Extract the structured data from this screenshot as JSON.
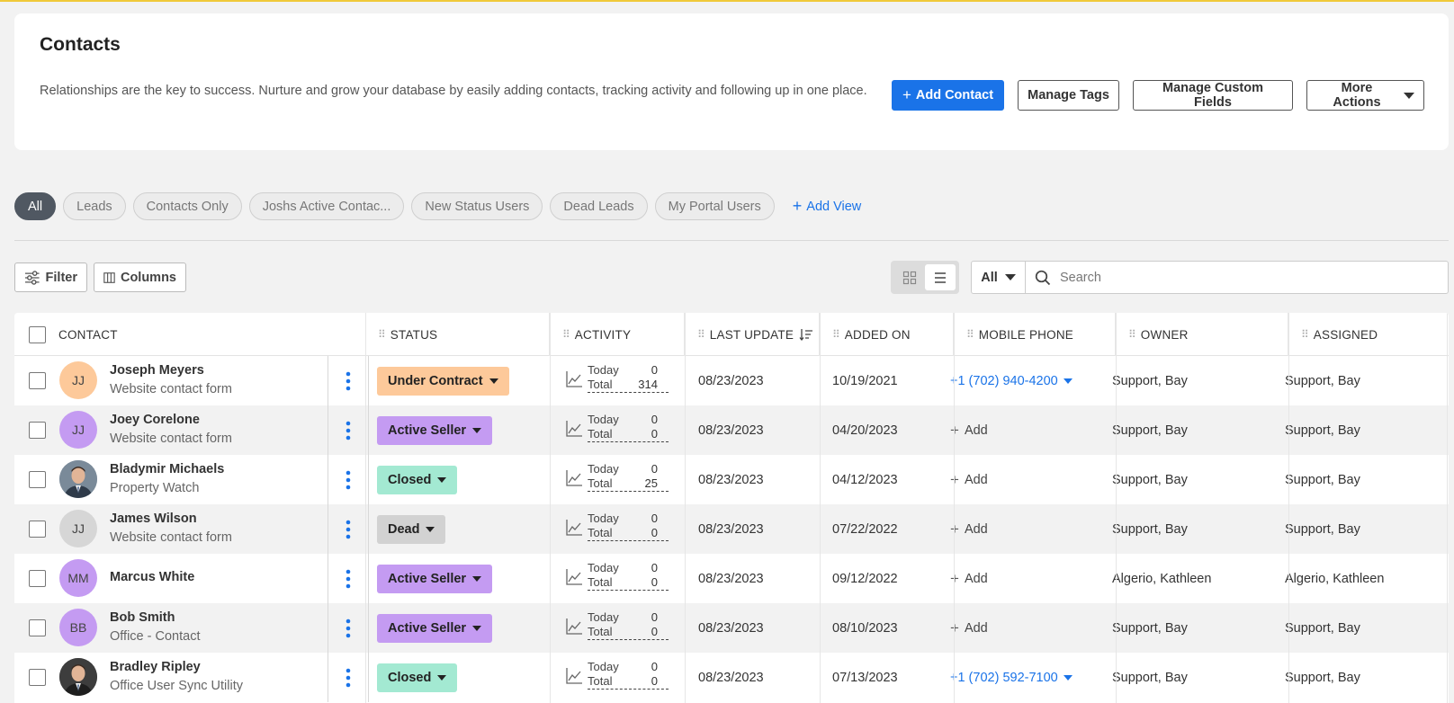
{
  "header": {
    "title": "Contacts",
    "description": "Relationships are the key to success. Nurture and grow your database by easily adding contacts, tracking activity and following up in one place.",
    "add_contact": "Add Contact",
    "manage_tags": "Manage Tags",
    "manage_custom_fields": "Manage Custom Fields",
    "more_actions": "More Actions"
  },
  "views": [
    "All",
    "Leads",
    "Contacts Only",
    "Joshs Active Contac...",
    "New Status Users",
    "Dead Leads",
    "My Portal Users"
  ],
  "add_view": "Add View",
  "toolbar": {
    "filter": "Filter",
    "columns": "Columns",
    "scope": "All",
    "search_placeholder": "Search"
  },
  "columns": [
    "CONTACT",
    "STATUS",
    "ACTIVITY",
    "LAST UPDATE",
    "ADDED ON",
    "MOBILE PHONE",
    "OWNER",
    "ASSIGNED"
  ],
  "activity_labels": {
    "today": "Today",
    "total": "Total"
  },
  "add_label": "Add",
  "colors": {
    "accent": "#1a73e8",
    "under_contract": "#fdc99a",
    "active_seller": "#c49bf2",
    "closed": "#a3e9d2",
    "dead": "#d2d2d2"
  },
  "contacts": [
    {
      "initials": "JJ",
      "avatar_color": "#fdc99a",
      "photo": false,
      "name": "Joseph Meyers",
      "source": "Website contact form",
      "status": "Under Contract",
      "status_color": "#fdc99a",
      "today": "0",
      "total": "314",
      "last_update": "08/23/2023",
      "added_on": "10/19/2021",
      "phone": "+1 (702) 940-4200",
      "owner": "Support, Bay",
      "assigned": "Support, Bay"
    },
    {
      "initials": "JJ",
      "avatar_color": "#c49bf2",
      "photo": false,
      "name": "Joey Corelone",
      "source": "Website contact form",
      "status": "Active Seller",
      "status_color": "#c49bf2",
      "today": "0",
      "total": "0",
      "last_update": "08/23/2023",
      "added_on": "04/20/2023",
      "phone": null,
      "owner": "Support, Bay",
      "assigned": "Support, Bay"
    },
    {
      "initials": "",
      "avatar_color": "#7a8a99",
      "photo": true,
      "name": "Bladymir Michaels",
      "source": "Property Watch",
      "status": "Closed",
      "status_color": "#a3e9d2",
      "today": "0",
      "total": "25",
      "last_update": "08/23/2023",
      "added_on": "04/12/2023",
      "phone": null,
      "owner": "Support, Bay",
      "assigned": "Support, Bay"
    },
    {
      "initials": "JJ",
      "avatar_color": "#d6d6d6",
      "photo": false,
      "name": "James Wilson",
      "source": "Website contact form",
      "status": "Dead",
      "status_color": "#d2d2d2",
      "today": "0",
      "total": "0",
      "last_update": "08/23/2023",
      "added_on": "07/22/2022",
      "phone": null,
      "owner": "Support, Bay",
      "assigned": "Support, Bay"
    },
    {
      "initials": "MM",
      "avatar_color": "#c49bf2",
      "photo": false,
      "name": "Marcus White",
      "source": "",
      "status": "Active Seller",
      "status_color": "#c49bf2",
      "today": "0",
      "total": "0",
      "last_update": "08/23/2023",
      "added_on": "09/12/2022",
      "phone": null,
      "owner": "Algerio, Kathleen",
      "assigned": "Algerio, Kathleen"
    },
    {
      "initials": "BB",
      "avatar_color": "#c49bf2",
      "photo": false,
      "name": "Bob Smith",
      "source": "Office - Contact",
      "status": "Active Seller",
      "status_color": "#c49bf2",
      "today": "0",
      "total": "0",
      "last_update": "08/23/2023",
      "added_on": "08/10/2023",
      "phone": null,
      "owner": "Support, Bay",
      "assigned": "Support, Bay"
    },
    {
      "initials": "",
      "avatar_color": "#3d3d3d",
      "photo": true,
      "name": "Bradley Ripley",
      "source": "Office User Sync Utility",
      "status": "Closed",
      "status_color": "#a3e9d2",
      "today": "0",
      "total": "0",
      "last_update": "08/23/2023",
      "added_on": "07/13/2023",
      "phone": "+1 (702) 592-7100",
      "owner": "Support, Bay",
      "assigned": "Support, Bay"
    }
  ]
}
